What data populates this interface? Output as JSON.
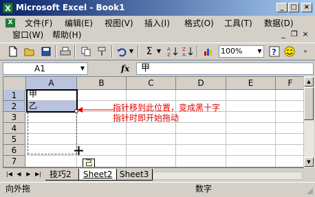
{
  "window": {
    "title": "Microsoft Excel - Book1",
    "minimize": "_",
    "maximize": "□",
    "close": "×"
  },
  "menu": {
    "items": [
      {
        "label": "文件(F)"
      },
      {
        "label": "编辑(E)"
      },
      {
        "label": "视图(V)"
      },
      {
        "label": "插入(I)"
      },
      {
        "label": "格式(O)"
      },
      {
        "label": "工具(T)"
      },
      {
        "label": "数据(D)"
      },
      {
        "label": "窗口(W)"
      },
      {
        "label": "帮助(H)"
      }
    ],
    "mdi_min": "_",
    "mdi_restore": "❐",
    "mdi_close": "×"
  },
  "toolbar": {
    "zoom": "100%",
    "sum_symbol": "Σ"
  },
  "formula_bar": {
    "name_box": "A1",
    "fx": "fx",
    "content": "甲"
  },
  "grid": {
    "columns": [
      "A",
      "B",
      "C",
      "D",
      "E",
      "F"
    ],
    "rows": [
      "1",
      "2",
      "3",
      "4",
      "5",
      "6",
      "7"
    ],
    "cells": {
      "A1": "甲",
      "A2": "乙"
    }
  },
  "sheets": {
    "tabs": [
      "技巧2",
      "Sheet2",
      "Sheet3"
    ],
    "active": "Sheet2"
  },
  "tooltip": "己",
  "annotation": {
    "line1": "指针移到此位置，变成黑十字",
    "line2": "指针时即开始拖动"
  },
  "status": {
    "left": "向外拖",
    "mode": "数字"
  },
  "colors": {
    "title_start": "#0a246a",
    "title_end": "#a6caf0",
    "annotation": "#e00000",
    "selection": "#b8c4de"
  }
}
